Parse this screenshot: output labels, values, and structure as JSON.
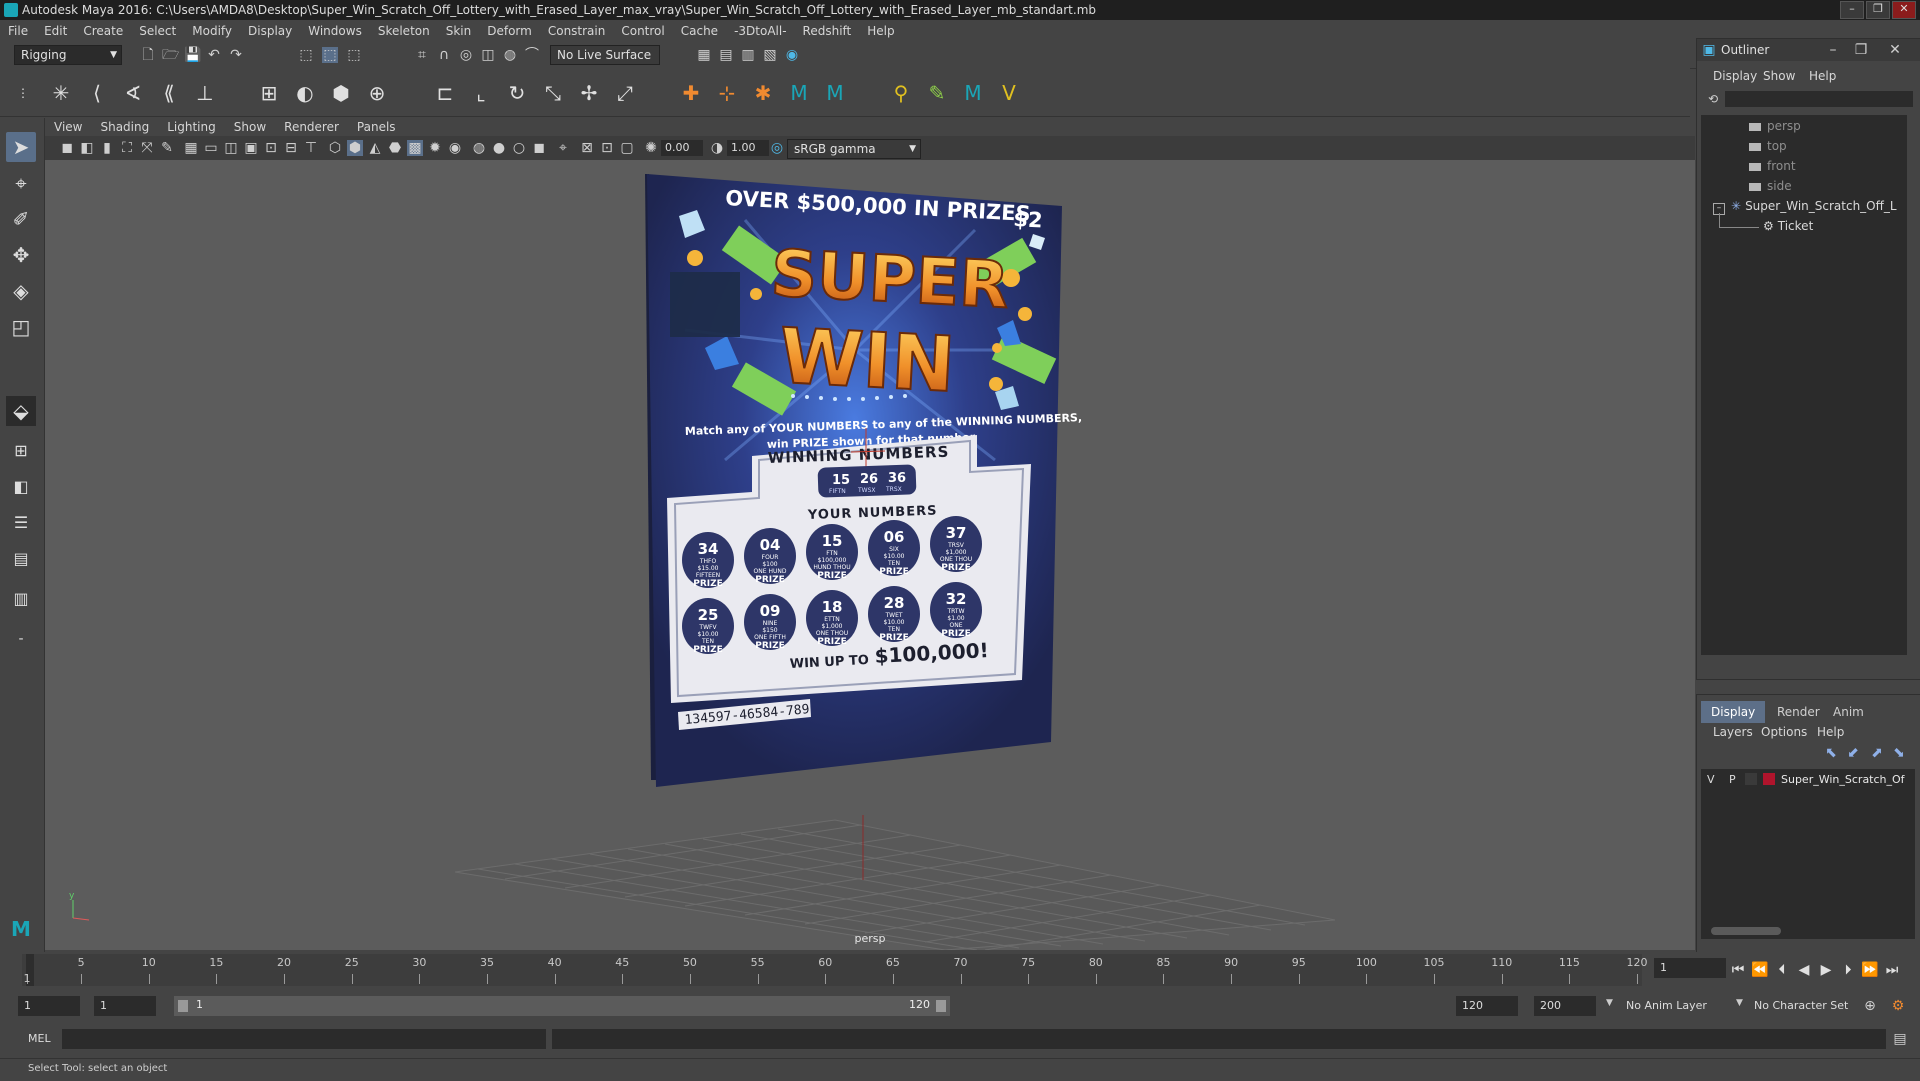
{
  "window": {
    "title": "Autodesk Maya 2016: C:\\Users\\AMDA8\\Desktop\\Super_Win_Scratch_Off_Lottery_with_Erased_Layer_max_vray\\Super_Win_Scratch_Off_Lottery_with_Erased_Layer_mb_standart.mb",
    "buttons": [
      "–",
      "❐",
      "✕"
    ]
  },
  "menubar": [
    "File",
    "Edit",
    "Create",
    "Select",
    "Modify",
    "Display",
    "Windows",
    "Skeleton",
    "Skin",
    "Deform",
    "Constrain",
    "Control",
    "Cache",
    "-3DtoAll-",
    "Redshift",
    "Help"
  ],
  "statusline": {
    "mode": "Rigging",
    "live_surface": "No Live Surface"
  },
  "panel": {
    "menus": [
      "View",
      "Shading",
      "Lighting",
      "Show",
      "Renderer",
      "Panels"
    ],
    "exposure": "0.00",
    "gamma": "1.00",
    "color_space": "sRGB gamma",
    "camera": "persp"
  },
  "ticket": {
    "header": "OVER $500,000 IN PRIZES",
    "price": "$2",
    "logo_top": "SUPER",
    "logo_bottom": "WIN",
    "instructions_1": "Match any of YOUR NUMBERS to any of the WINNING NUMBERS,",
    "instructions_2": "win PRIZE shown for that number.",
    "winning_title": "WINNING NUMBERS",
    "winning_numbers": [
      "15",
      "26",
      "36"
    ],
    "winning_sub": [
      "FIFTN",
      "TWSX",
      "TRSX"
    ],
    "your_title": "YOUR NUMBERS",
    "your_numbers": [
      {
        "n": "34",
        "w": "THFO",
        "p": "$15.00",
        "pw": "FIFTEEN"
      },
      {
        "n": "04",
        "w": "FOUR",
        "p": "$100",
        "pw": "ONE HUND"
      },
      {
        "n": "15",
        "w": "FTN",
        "p": "$100,000",
        "pw": "HUND THOU"
      },
      {
        "n": "06",
        "w": "SIX",
        "p": "$10.00",
        "pw": "TEN"
      },
      {
        "n": "37",
        "w": "TRSV",
        "p": "$1,000",
        "pw": "ONE THOU"
      },
      {
        "n": "25",
        "w": "TWFV",
        "p": "$10.00",
        "pw": "TEN"
      },
      {
        "n": "09",
        "w": "NINE",
        "p": "$150",
        "pw": "ONE FIFTH"
      },
      {
        "n": "18",
        "w": "ETTN",
        "p": "$1,000",
        "pw": "ONE THOU"
      },
      {
        "n": "28",
        "w": "TWET",
        "p": "$10.00",
        "pw": "TEN"
      },
      {
        "n": "32",
        "w": "TRTW",
        "p": "$1.00",
        "pw": "ONE"
      }
    ],
    "prize_word": "PRIZE",
    "win_up_to": "WIN UP TO",
    "win_amount": "$100,000!",
    "serial": "134597-46584-789"
  },
  "outliner": {
    "title": "Outliner",
    "menus": [
      "Display",
      "Show",
      "Help"
    ],
    "items": [
      {
        "label": "persp",
        "type": "camera"
      },
      {
        "label": "top",
        "type": "camera"
      },
      {
        "label": "front",
        "type": "camera"
      },
      {
        "label": "side",
        "type": "camera"
      },
      {
        "label": "Super_Win_Scratch_Off_L",
        "type": "group"
      },
      {
        "label": "Ticket",
        "type": "mesh"
      }
    ]
  },
  "layer_editor": {
    "tabs": [
      "Display",
      "Render",
      "Anim"
    ],
    "menus": [
      "Layers",
      "Options",
      "Help"
    ],
    "layer": {
      "v": "V",
      "p": "P",
      "name": "Super_Win_Scratch_Of",
      "color": "#b0142c"
    }
  },
  "timeline": {
    "ticks": [
      1,
      5,
      10,
      15,
      20,
      25,
      30,
      35,
      40,
      45,
      50,
      55,
      60,
      65,
      70,
      75,
      80,
      85,
      90,
      95,
      100,
      105,
      110,
      115,
      120
    ],
    "current_frame": "1"
  },
  "range": {
    "start": "1",
    "playback_start": "1",
    "range_start_label": "1",
    "range_end_label": "120",
    "playback_end": "120",
    "end": "200",
    "anim_layer": "No Anim Layer",
    "char_set": "No Character Set"
  },
  "cmdline": {
    "label": "MEL"
  },
  "helpline": {
    "text": "Select Tool: select an object"
  },
  "colors": {
    "accent": "#5d6f88",
    "ticket_bg": "#2b3566",
    "ticket_gold": "#f0a030"
  }
}
